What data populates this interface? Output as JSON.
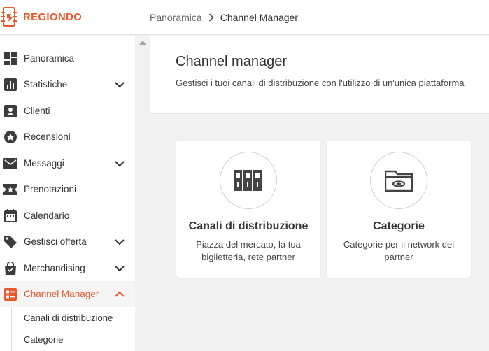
{
  "app": {
    "logo_text": "REGIONDO",
    "accent_color": "#e9572a"
  },
  "breadcrumb": {
    "items": [
      "Panoramica",
      "Channel Manager"
    ]
  },
  "sidebar": {
    "items": [
      {
        "label": "Panoramica",
        "icon": "dashboard-icon"
      },
      {
        "label": "Statistiche",
        "icon": "bar-chart-icon",
        "expandable": true
      },
      {
        "label": "Clienti",
        "icon": "contact-card-icon"
      },
      {
        "label": "Recensioni",
        "icon": "star-badge-icon"
      },
      {
        "label": "Messaggi",
        "icon": "mail-icon",
        "expandable": true
      },
      {
        "label": "Prenotazioni",
        "icon": "ticket-star-icon"
      },
      {
        "label": "Calendario",
        "icon": "calendar-icon"
      },
      {
        "label": "Gestisci offerta",
        "icon": "tag-icon",
        "expandable": true
      },
      {
        "label": "Merchandising",
        "icon": "shopping-bag-icon",
        "expandable": true
      },
      {
        "label": "Channel Manager",
        "icon": "channel-manager-icon",
        "expanded": true,
        "active": true
      }
    ],
    "sub_items": [
      "Canali di distribuzione",
      "Categorie"
    ]
  },
  "header": {
    "title": "Channel manager",
    "subtitle": "Gestisci i tuoi canali di distribuzione con l'utilizzo di un'unica piattaforma"
  },
  "cards": [
    {
      "title": "Canali di distribuzione",
      "description": "Piazza del mercato, la tua biglietteria, rete partner",
      "icon": "binders-icon"
    },
    {
      "title": "Categorie",
      "description": "Categorie per il network dei partner",
      "icon": "folder-icon"
    }
  ]
}
